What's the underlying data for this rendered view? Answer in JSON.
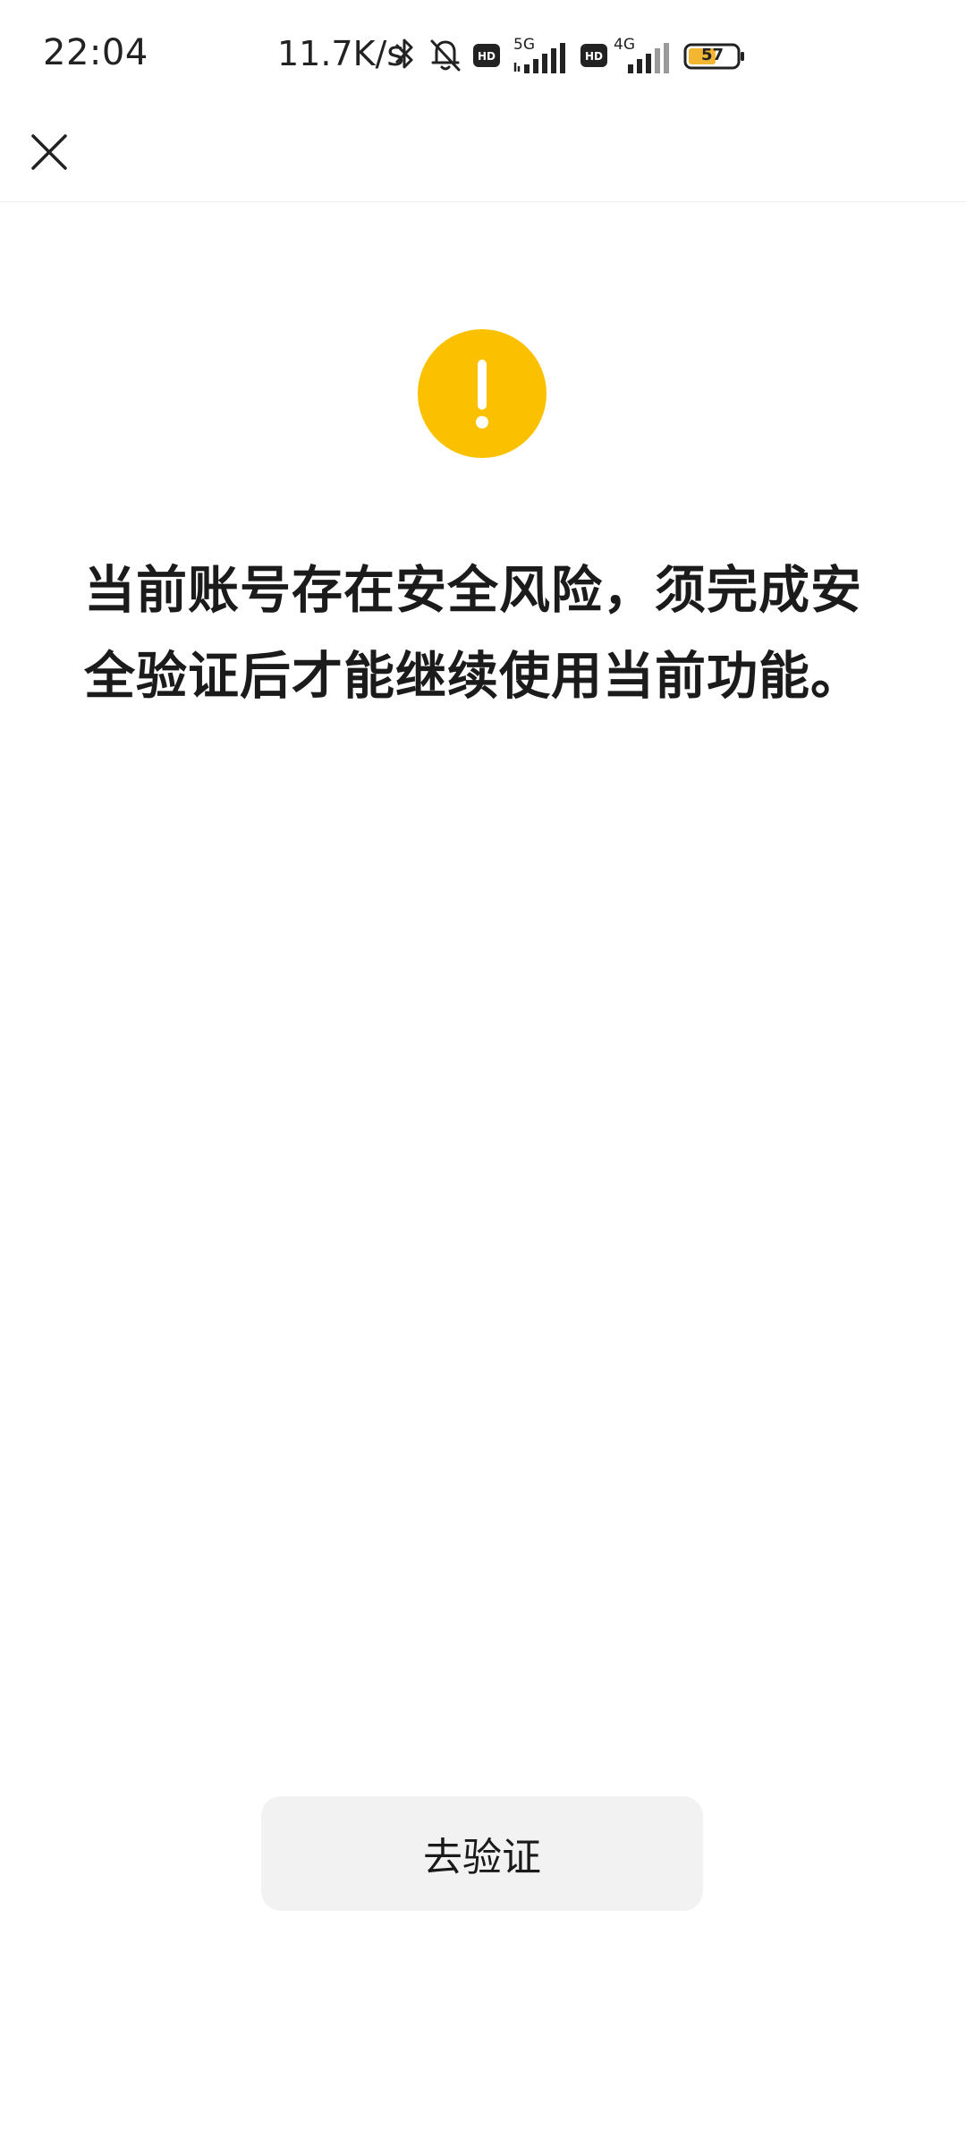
{
  "status_bar": {
    "time": "22:04",
    "net_speed": "11.7K/s",
    "network_1": "5G",
    "network_2": "4G",
    "hd_label": "HD",
    "battery_level": "57",
    "icons": [
      "bluetooth-icon",
      "mute-bell-icon",
      "hd-icon",
      "signal-5g-icon",
      "hd-icon",
      "signal-4g-icon",
      "battery-icon"
    ]
  },
  "nav": {
    "close_icon": "close-icon"
  },
  "alert": {
    "icon": "warning-exclamation-icon",
    "icon_color": "#fbc100",
    "message": "当前账号存在安全风险，须完成安全验证后才能继续使用当前功能。"
  },
  "actions": {
    "verify_label": "去验证"
  }
}
